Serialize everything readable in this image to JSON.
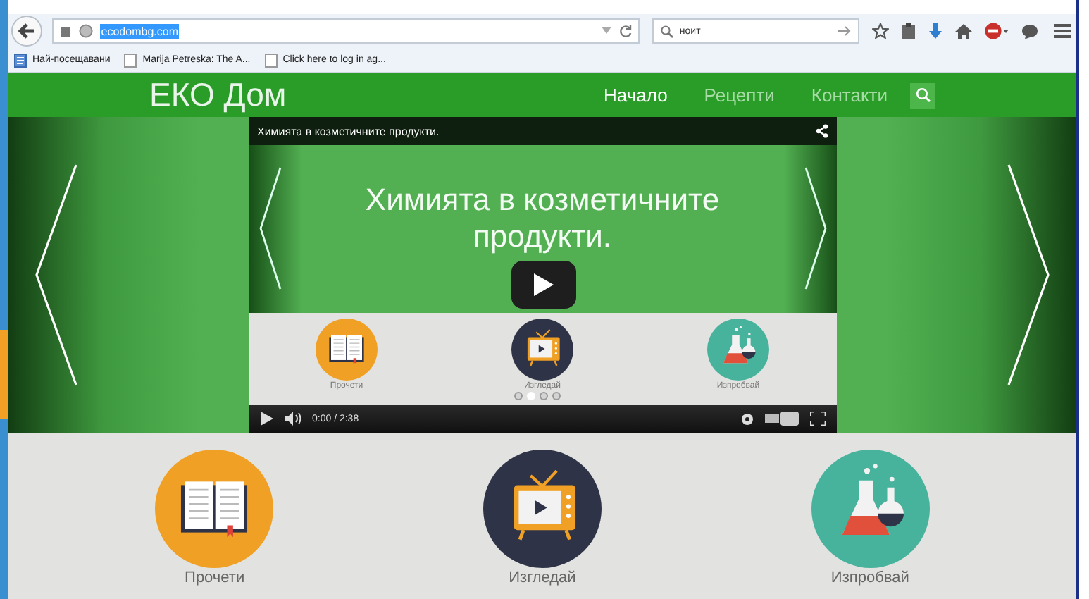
{
  "browser": {
    "url": "ecodombg.com",
    "url_selected": true,
    "search": "ноит",
    "bookmarks": [
      "Най-посещавани",
      "Marija Petreska: The A...",
      "Click here to log in ag..."
    ]
  },
  "site": {
    "logo": "ЕКО Дом",
    "nav": [
      {
        "label": "Начало",
        "selected": true
      },
      {
        "label": "Рецепти",
        "selected": false
      },
      {
        "label": "Контакти",
        "selected": false
      }
    ]
  },
  "video": {
    "title": "Химията в козметичните продукти.",
    "slide_text": "Химията в козметичните продукти.",
    "features": [
      {
        "kind": "book",
        "label": "Прочети"
      },
      {
        "kind": "tv",
        "label": "Изгледай"
      },
      {
        "kind": "flask",
        "label": "Изпробвай"
      }
    ],
    "dots": [
      {
        "selected": false
      },
      {
        "selected": true
      },
      {
        "selected": false
      },
      {
        "selected": false
      }
    ],
    "time": "0:00 / 2:38"
  },
  "features": [
    {
      "kind": "book",
      "label": "Прочети"
    },
    {
      "kind": "tv",
      "label": "Изгледай"
    },
    {
      "kind": "flask",
      "label": "Изпробвай"
    }
  ]
}
